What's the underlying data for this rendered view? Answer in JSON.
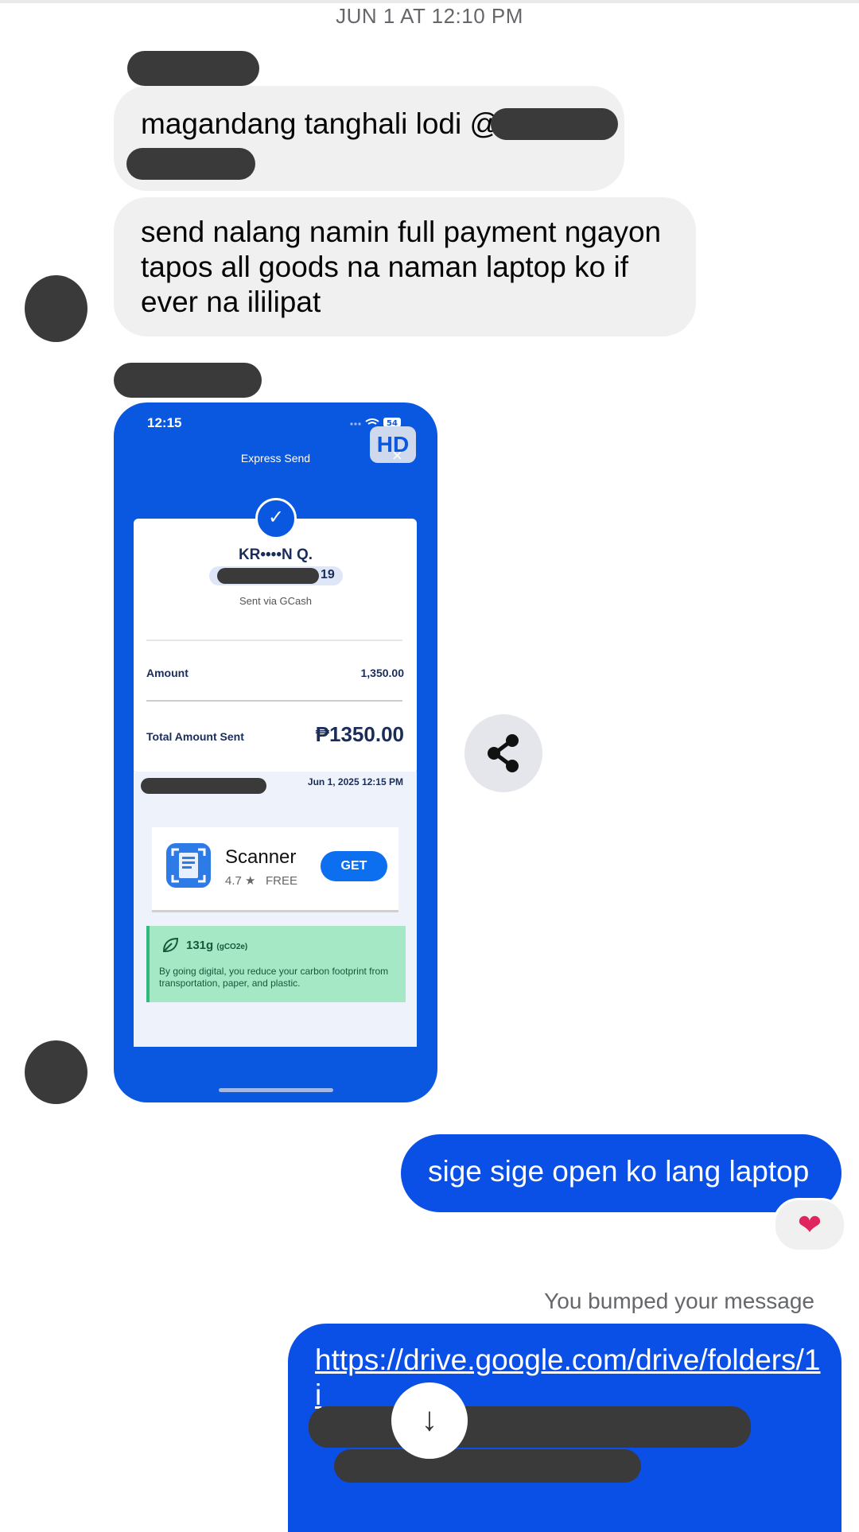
{
  "conversation": {
    "date_header": "JUN 1 AT 12:10 PM"
  },
  "messages": {
    "msg1_text": "magandang tanghali lodi @",
    "msg2_text": "send nalang namin full payment ngayon tapos all goods na naman laptop ko if ever na ililipat",
    "msg3_text": "sige sige open ko lang laptop",
    "msg3_reaction": "❤",
    "bump_notice": "You bumped your message",
    "msg4_link": "https://drive.google.com/drive/folders/1i"
  },
  "attachment": {
    "status_time": "12:15",
    "battery": "54",
    "hd_badge": "HD",
    "screen_title": "Express Send",
    "close_symbol": "×",
    "check_symbol": "✓",
    "recipient_name": "KR••••N Q.",
    "recipient_acct_tail": "19",
    "sent_via": "Sent via GCash",
    "amount_label": "Amount",
    "amount_value": "1,350.00",
    "total_label": "Total Amount Sent",
    "total_value": "₱1350.00",
    "timestamp": "Jun 1, 2025 12:15 PM",
    "ad": {
      "app_name": "Scanner",
      "rating": "4.7 ★",
      "price": "FREE",
      "button": "GET"
    },
    "eco": {
      "amount": "131g",
      "unit": "(gCO2e)",
      "description": "By going digital, you reduce your carbon footprint from transportation, paper, and plastic."
    }
  },
  "icons": {
    "share": "share-icon",
    "heart": "heart-icon",
    "scroll_down": "arrow-down-icon"
  },
  "colors": {
    "outgoing_bubble": "#0a4fe6",
    "incoming_bubble": "#f0f0f0",
    "gcash_blue": "#0b58e0"
  }
}
